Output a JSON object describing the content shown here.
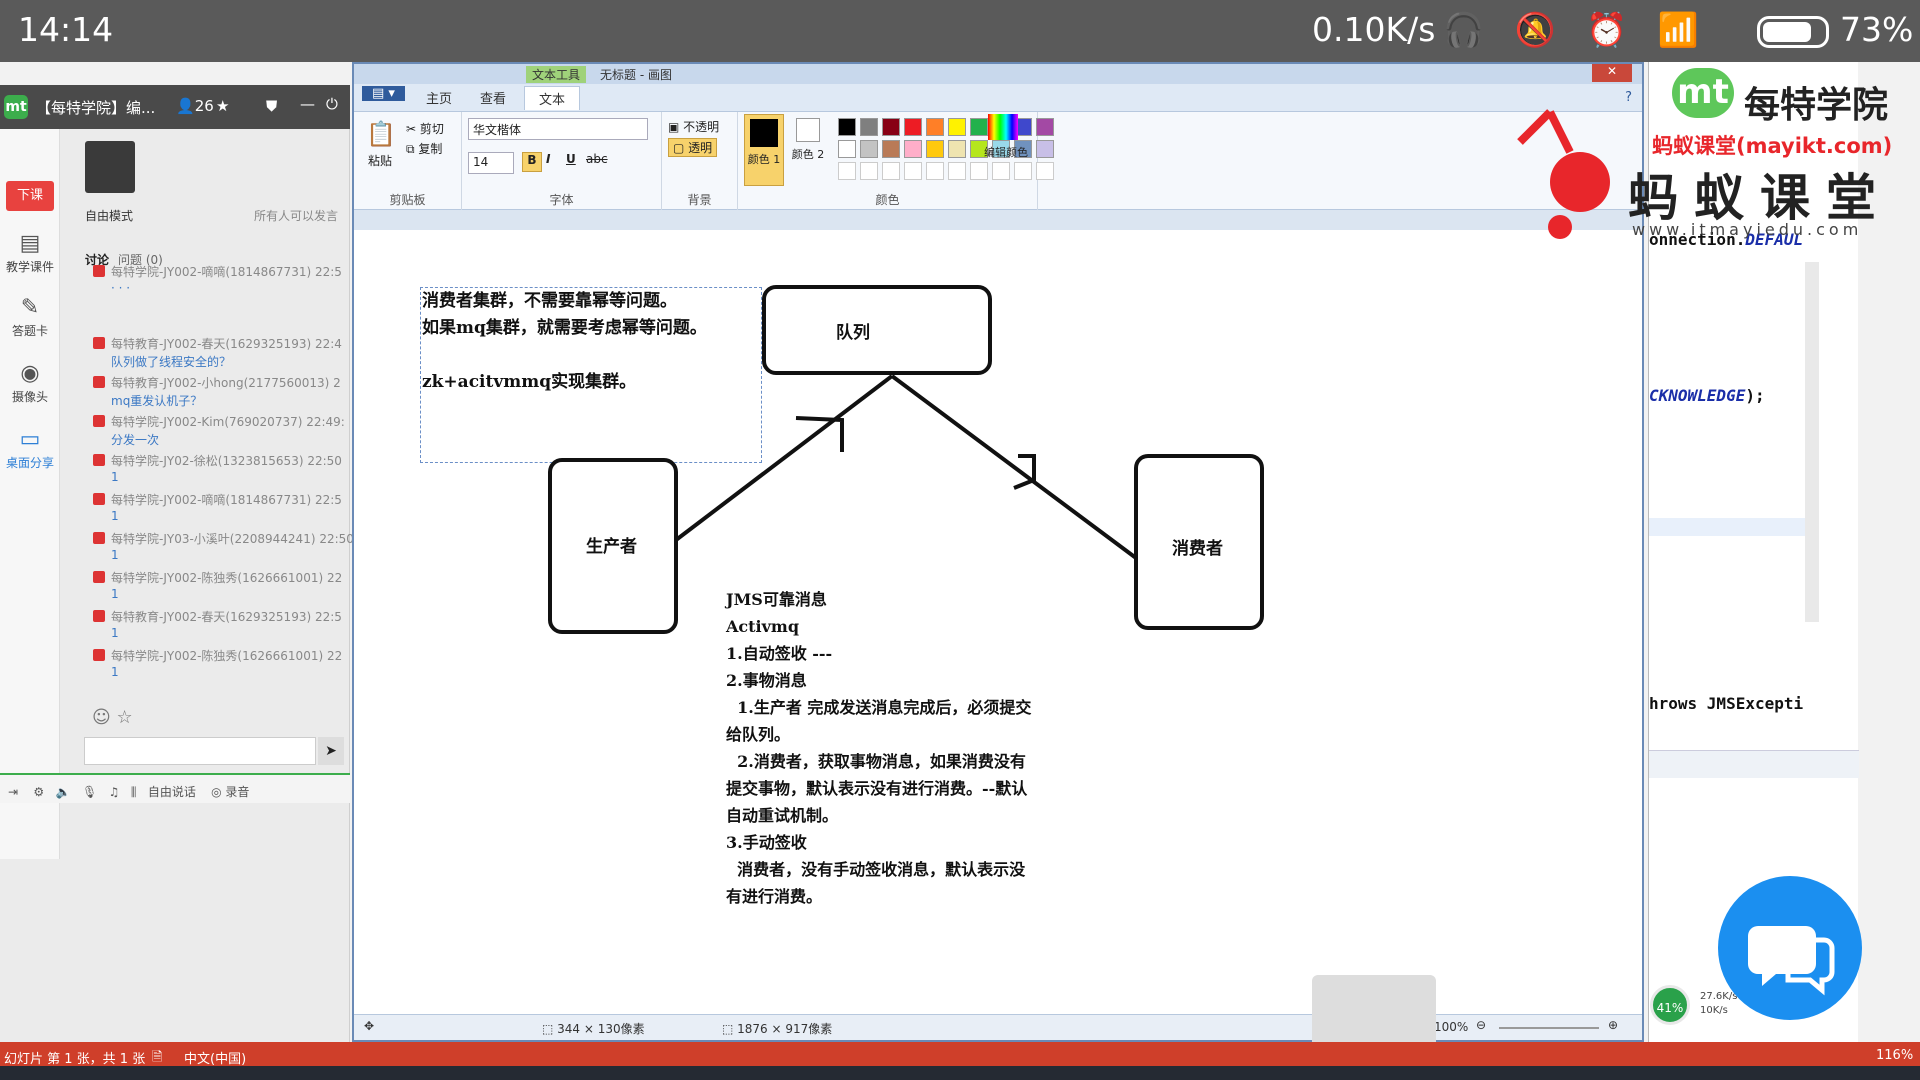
{
  "status_bar": {
    "time": "14:14",
    "speed": "0.10K/s",
    "battery": "73%"
  },
  "qq_panel": {
    "title": "【每特学院】编...",
    "member_count": "26",
    "nav": {
      "xiake": "下课",
      "courseware": "教学课件",
      "answer_card": "答题卡",
      "camera": "摄像头",
      "desktop_share": "桌面分享"
    },
    "mode": "自由模式",
    "mode_note": "所有人可以发言",
    "tabs": {
      "discuss": "讨论",
      "question": "问题",
      "question_count": "(0)"
    },
    "messages": [
      {
        "user": "每特学院-JY002-嘀嘀(1814867731) 22:5",
        "text": "· · ·"
      },
      {
        "user": "每特教育-JY002-春天(1629325193) 22:4",
        "text": "队列做了线程安全的？"
      },
      {
        "user": "每特教育-JY002-小hong(2177560013) 2",
        "text": "mq重发认机子？"
      },
      {
        "user": "每特学院-JY002-Kim(769020737) 22:49:",
        "text": "分发一次"
      },
      {
        "user": "每特学院-JY02-徐松(1323815653) 22:50",
        "text": "1"
      },
      {
        "user": "每特学院-JY002-嘀嘀(1814867731) 22:5",
        "text": "1"
      },
      {
        "user": "每特学院-JY03-小溪叶(2208944241) 22:50:",
        "text": "1"
      },
      {
        "user": "每特学院-JY002-陈独秀(1626661001) 22",
        "text": "1"
      },
      {
        "user": "每特教育-JY002-春天(1629325193) 22:5",
        "text": "1"
      },
      {
        "user": "每特学院-JY002-陈独秀(1626661001) 22",
        "text": "1"
      }
    ],
    "toolbar": {
      "free_talk": "自由说话",
      "record": "录音"
    }
  },
  "paint": {
    "title": "无标题 - 画图",
    "text_tool": "文本工具",
    "tabs": [
      "主页",
      "查看",
      "文本"
    ],
    "clipboard": {
      "paste": "粘贴",
      "cut": "剪切",
      "copy": "复制",
      "label": "剪贴板"
    },
    "font": {
      "family": "华文楷体",
      "size": "14",
      "label": "字体"
    },
    "background": {
      "opaque": "不透明",
      "transparent": "透明",
      "label": "背景"
    },
    "colors": {
      "color1": "颜色 1",
      "color2": "颜色 2",
      "edit": "编辑颜色",
      "label": "颜色"
    },
    "palette": [
      "#000000",
      "#7f7f7f",
      "#880015",
      "#ed1c24",
      "#ff7f27",
      "#fff200",
      "#22b14c",
      "#00a2e8",
      "#3f48cc",
      "#a349a4",
      "#ffffff",
      "#c3c3c3",
      "#b97a57",
      "#ffaec9",
      "#ffc90e",
      "#efe4b0",
      "#b5e61d",
      "#99d9ea",
      "#7092be",
      "#c8bfe7"
    ],
    "canvas": {
      "note": "消费者集群，不需要靠幂等问题。\n如果mq集群，就需要考虑幂等问题。\n\nzk+acitvmmq实现集群。",
      "queue": "队列",
      "producer": "生产者",
      "consumer": "消费者",
      "jms": "JMS可靠消息\nActivmq\n1.自动签收 ---\n2.事物消息\n  1.生产者 完成发送消息完成后，必须提交\n给队列。\n  2.消费者，获取事物消息，如果消费没有\n提交事物，默认表示没有进行消费。--默认\n自动重试机制。\n3.手动签收\n  消费者，没有手动签收消息，默认表示没\n有进行消费。"
    },
    "status": {
      "selection": "344 × 130像素",
      "size": "1876 × 917像素",
      "zoom": "100%"
    }
  },
  "ide": {
    "line1_a": "onnection.",
    "line1_b": "DEFAUL",
    "line2": "CKNOWLEDGE",
    "line2_tail": ");",
    "line3": "hrows JMSExcepti"
  },
  "brand": {
    "name": "每特学院",
    "mayi": "蚂蚁课堂",
    "site": "(mayikt.com)",
    "url": "www.itmayiedu.com"
  },
  "taskbar": {
    "slide": "幻灯片 第 1 张，共 1 张",
    "lang": "中文(中国)",
    "zoom": "116%"
  },
  "widget": {
    "pct": "41%",
    "up": "27.6K/s",
    "down": "10K/s"
  }
}
